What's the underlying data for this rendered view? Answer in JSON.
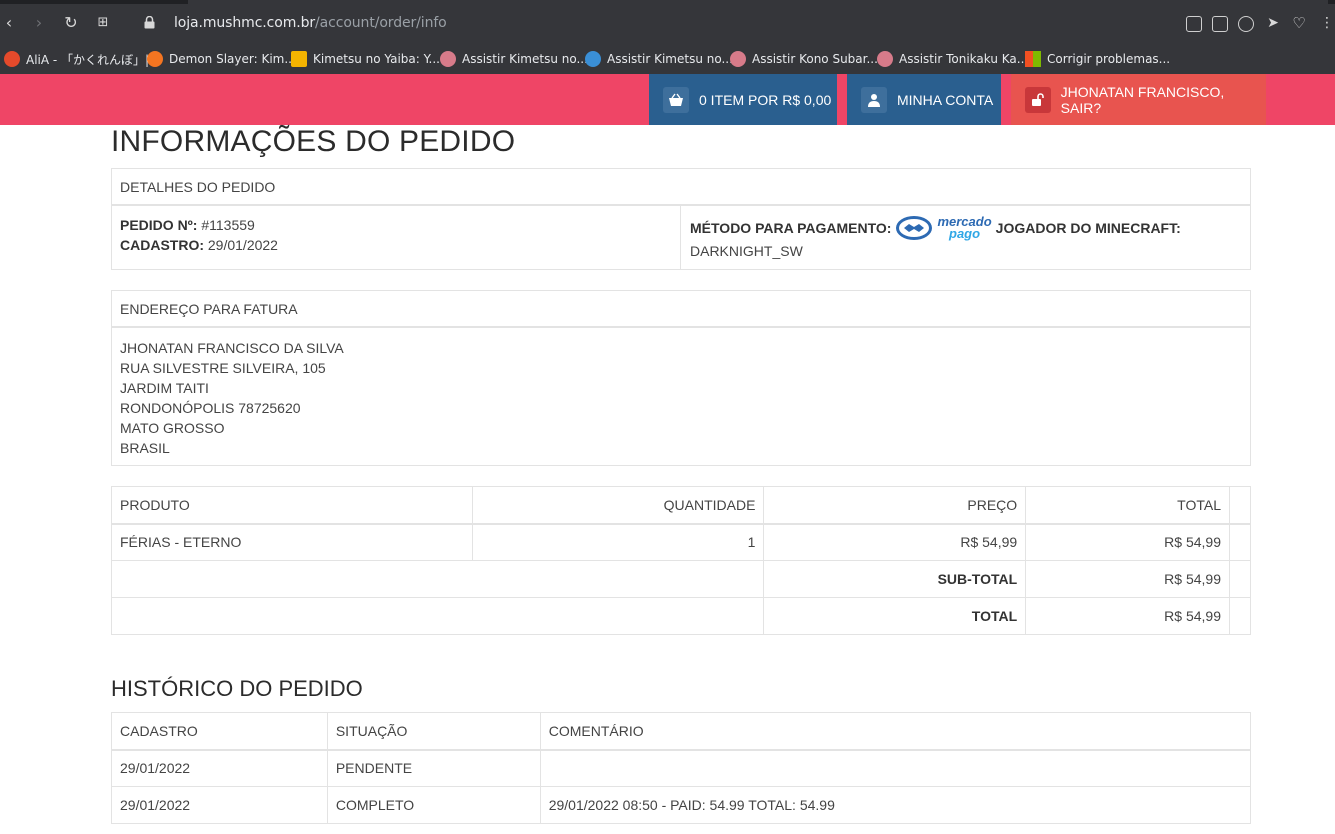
{
  "browser": {
    "url_host": "loja.mushmc.com.br",
    "url_path": "/account/order/info",
    "bookmarks": [
      {
        "label": "AliA - 「かくれんぼ」|...",
        "color": "#e54a2b"
      },
      {
        "label": "Demon Slayer: Kim...",
        "color": "#f47521"
      },
      {
        "label": "Kimetsu no Yaiba: Y...",
        "color": "#f4b400"
      },
      {
        "label": "Assistir Kimetsu no...",
        "color": "#d77b8a"
      },
      {
        "label": "Assistir Kimetsu no...",
        "color": "#3a8fd6"
      },
      {
        "label": "Assistir Kono Subar...",
        "color": "#d77b8a"
      },
      {
        "label": "Assistir Tonikaku Ka...",
        "color": "#d77b8a"
      },
      {
        "label": "Corrigir problemas...",
        "color": "#00a4ef"
      }
    ]
  },
  "nav": {
    "cart_label": "0 ITEM POR R$ 0,00",
    "account_label": "MINHA CONTA",
    "logout_label": "JHONATAN FRANCISCO, SAIR?"
  },
  "page": {
    "title": "INFORMAÇÕES DO PEDIDO",
    "details": {
      "header": "DETALHES DO PEDIDO",
      "order_label": "PEDIDO Nº:",
      "order_value": "#113559",
      "date_label": "CADASTRO:",
      "date_value": "29/01/2022",
      "payment_label": "MÉTODO PARA PAGAMENTO:",
      "payment_logo_text_1": "mercado",
      "payment_logo_text_2": "pago",
      "player_label": "JOGADOR DO MINECRAFT:",
      "player_value": "DARKNIGHT_SW"
    },
    "address": {
      "header": "ENDEREÇO PARA FATURA",
      "lines": [
        "JHONATAN FRANCISCO DA SILVA",
        "RUA SILVESTRE SILVEIRA, 105",
        "JARDIM TAITI",
        "RONDONÓPOLIS 78725620",
        "MATO GROSSO",
        "BRASIL"
      ]
    },
    "products": {
      "headers": [
        "PRODUTO",
        "QUANTIDADE",
        "PREÇO",
        "TOTAL"
      ],
      "rows": [
        [
          "FÉRIAS - ETERNO",
          "1",
          "R$ 54,99",
          "R$ 54,99"
        ]
      ],
      "subtotal_label": "SUB-TOTAL",
      "subtotal_value": "R$ 54,99",
      "total_label": "TOTAL",
      "total_value": "R$ 54,99"
    },
    "history": {
      "title": "HISTÓRICO DO PEDIDO",
      "headers": [
        "CADASTRO",
        "SITUAÇÃO",
        "COMENTÁRIO"
      ],
      "rows": [
        [
          "29/01/2022",
          "PENDENTE",
          ""
        ],
        [
          "29/01/2022",
          "COMPLETO",
          "29/01/2022 08:50 - PAID: 54.99 TOTAL: 54.99"
        ]
      ]
    }
  }
}
